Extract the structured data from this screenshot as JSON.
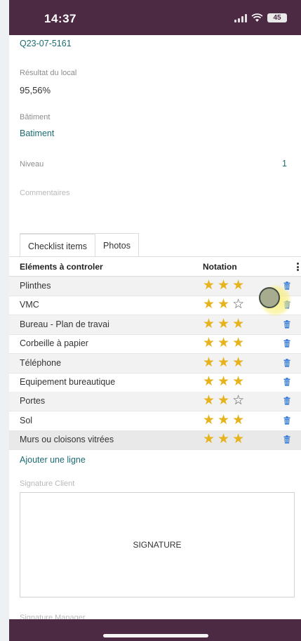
{
  "status": {
    "time": "14:37",
    "battery": "45"
  },
  "form": {
    "reference": "Q23-07-5161",
    "result_label": "Résultat du local",
    "result_value": "95,56%",
    "building_label": "Bâtiment",
    "building_value": "Batiment",
    "level_label": "Niveau",
    "level_value": "1",
    "comments_label": "Commentaires"
  },
  "tabs": [
    {
      "label": "Checklist items",
      "active": true
    },
    {
      "label": "Photos",
      "active": false
    }
  ],
  "table": {
    "col_element": "Eléments à controler",
    "col_rating": "Notation",
    "rows": [
      {
        "name": "Plinthes",
        "rating": 3
      },
      {
        "name": "VMC",
        "rating": 2
      },
      {
        "name": "Bureau - Plan de travai",
        "rating": 3
      },
      {
        "name": "Corbeille à papier",
        "rating": 3
      },
      {
        "name": "Téléphone",
        "rating": 3
      },
      {
        "name": "Equipement bureautique",
        "rating": 3
      },
      {
        "name": "Portes",
        "rating": 2
      },
      {
        "name": "Sol",
        "rating": 3
      },
      {
        "name": "Murs ou cloisons vitrées",
        "rating": 3
      }
    ],
    "max_rating": 3,
    "add_line": "Ajouter une ligne"
  },
  "signature": {
    "client_label": "Signature Client",
    "placeholder": "SIGNATURE",
    "manager_label": "Signature Manager"
  },
  "colors": {
    "bar": "#4d2a43",
    "accent_link": "#1d6b72",
    "star_filled": "#e6b31c",
    "trash": "#3b7dd8"
  }
}
